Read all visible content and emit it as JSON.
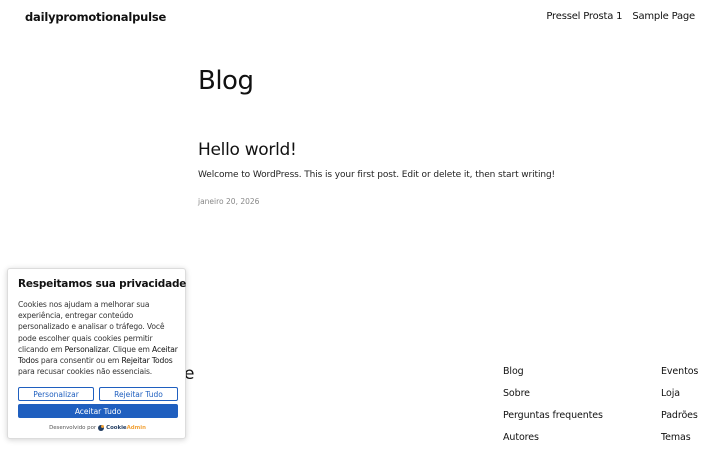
{
  "header": {
    "site_title": "dailypromotionalpulse",
    "nav": [
      "Pressel Prosta 1",
      "Sample Page"
    ]
  },
  "main": {
    "heading": "Blog",
    "post": {
      "title": "Hello world!",
      "excerpt": "Welcome to WordPress. This is your first post. Edit or delete it, then start writing!",
      "date": "janeiro 20, 2026"
    }
  },
  "footer": {
    "title_fragment": "e",
    "col1": [
      "Blog",
      "Sobre",
      "Perguntas frequentes",
      "Autores"
    ],
    "col2": [
      "Eventos",
      "Loja",
      "Padrões",
      "Temas"
    ]
  },
  "cookie_banner": {
    "title": "Respeitamos sua privacidade",
    "text_1": "Cookies nos ajudam a melhorar sua experiência, entregar conteúdo personalizado e analisar o tráfego. Você pode escolher quais cookies permitir clicando em ",
    "personalize_word": "Personalizar",
    "text_2": ". Clique em ",
    "accept_all_word": "Aceitar Todos",
    "text_3": " para consentir ou em ",
    "reject_all_word": "Rejeitar Todos",
    "text_4": " para recusar cookies não essenciais.",
    "buttons": {
      "customize": "Personalizar",
      "reject": "Rejeitar Tudo",
      "accept": "Aceitar Tudo"
    },
    "powered_by": "Desenvolvido por",
    "brand_part1": "Cookie",
    "brand_part2": "Admin",
    "accent_color": "#1f5fbf"
  }
}
